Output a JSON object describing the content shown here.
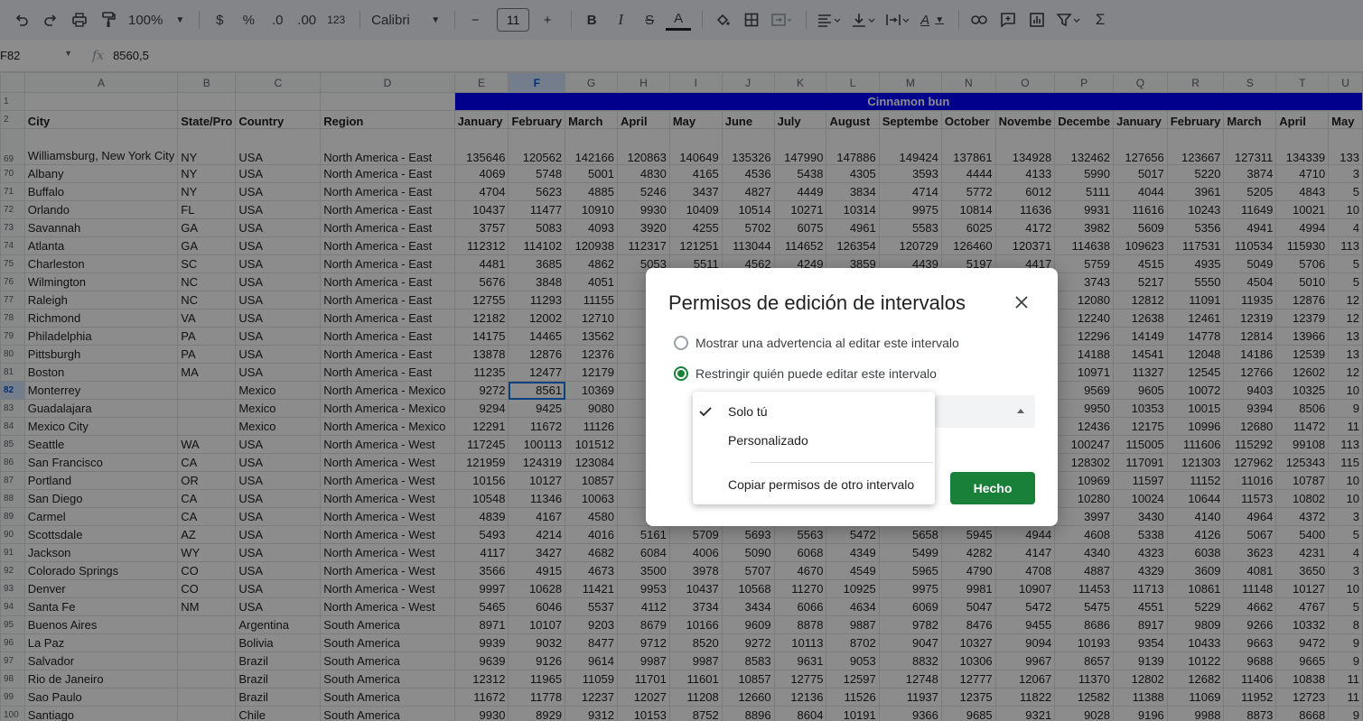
{
  "toolbar": {
    "zoom": "100%",
    "currency": "$",
    "percent": "%",
    "dec_decrease": ".0",
    "dec_increase": ".00",
    "number_format": "123",
    "font": "Calibri",
    "font_size": "11",
    "bold": "B",
    "italic": "I",
    "strike": "S",
    "text_color": "A",
    "text_rotate": "A",
    "sum": "Σ"
  },
  "formula_bar": {
    "cell_ref": "F82",
    "fx": "fx",
    "value": "8560,5"
  },
  "columns": [
    "A",
    "B",
    "C",
    "D",
    "E",
    "F",
    "G",
    "H",
    "I",
    "J",
    "K",
    "L",
    "M",
    "N",
    "O",
    "P",
    "Q",
    "R",
    "S",
    "T",
    "U"
  ],
  "banner": "Cinnamon bun",
  "headers": [
    "City",
    "State/Pro",
    "Country",
    "Region",
    "January",
    "February",
    "March",
    "April",
    "May",
    "June",
    "July",
    "August",
    "Septembe",
    "October",
    "Novembe",
    "Decembe",
    "January",
    "February",
    "March",
    "April",
    "May"
  ],
  "rows": [
    {
      "n": "69",
      "c": [
        "Williamsburg, New York City",
        "NY",
        "USA",
        "North America - East",
        "135646",
        "120562",
        "142166",
        "120863",
        "140649",
        "135326",
        "147990",
        "147886",
        "149424",
        "137861",
        "134928",
        "132462",
        "127656",
        "123667",
        "127311",
        "134339",
        "133"
      ]
    },
    {
      "n": "70",
      "c": [
        "Albany",
        "NY",
        "USA",
        "North America - East",
        "4069",
        "5748",
        "5001",
        "4830",
        "4165",
        "4536",
        "5438",
        "4305",
        "3593",
        "4444",
        "4133",
        "5990",
        "5017",
        "5220",
        "3874",
        "4710",
        "3"
      ]
    },
    {
      "n": "71",
      "c": [
        "Buffalo",
        "NY",
        "USA",
        "North America - East",
        "4704",
        "5623",
        "4885",
        "5246",
        "3437",
        "4827",
        "4449",
        "3834",
        "4714",
        "5772",
        "6012",
        "5111",
        "4044",
        "3961",
        "5205",
        "4843",
        "5"
      ]
    },
    {
      "n": "72",
      "c": [
        "Orlando",
        "FL",
        "USA",
        "North America - East",
        "10437",
        "11477",
        "10910",
        "9930",
        "10409",
        "10514",
        "10271",
        "10314",
        "9975",
        "10814",
        "11636",
        "9931",
        "11616",
        "10243",
        "11649",
        "10021",
        "10"
      ]
    },
    {
      "n": "73",
      "c": [
        "Savannah",
        "GA",
        "USA",
        "North America - East",
        "3757",
        "5083",
        "4093",
        "3920",
        "4255",
        "5702",
        "6075",
        "4961",
        "5583",
        "6025",
        "4172",
        "3982",
        "5609",
        "5356",
        "4941",
        "4994",
        "4"
      ]
    },
    {
      "n": "74",
      "c": [
        "Atlanta",
        "GA",
        "USA",
        "North America - East",
        "112312",
        "114102",
        "120938",
        "112317",
        "121251",
        "113044",
        "114652",
        "126354",
        "120729",
        "126460",
        "120371",
        "114638",
        "109623",
        "117531",
        "110534",
        "115930",
        "113"
      ]
    },
    {
      "n": "75",
      "c": [
        "Charleston",
        "SC",
        "USA",
        "North America - East",
        "4481",
        "3685",
        "4862",
        "5053",
        "5511",
        "4562",
        "4249",
        "3859",
        "4439",
        "5197",
        "4417",
        "5759",
        "4515",
        "4935",
        "5049",
        "5706",
        "5"
      ]
    },
    {
      "n": "76",
      "c": [
        "Wilmington",
        "NC",
        "USA",
        "North America - East",
        "5676",
        "3848",
        "4051",
        "4",
        "",
        "",
        "",
        "",
        "",
        "",
        "",
        "3743",
        "5217",
        "5550",
        "4504",
        "5010",
        "5"
      ]
    },
    {
      "n": "77",
      "c": [
        "Raleigh",
        "NC",
        "USA",
        "North America - East",
        "12755",
        "11293",
        "11155",
        "11",
        "",
        "",
        "",
        "",
        "",
        "",
        "",
        "12080",
        "12812",
        "11091",
        "11935",
        "12876",
        "12"
      ]
    },
    {
      "n": "78",
      "c": [
        "Richmond",
        "VA",
        "USA",
        "North America - East",
        "12182",
        "12002",
        "12710",
        "12",
        "",
        "",
        "",
        "",
        "",
        "",
        "",
        "12240",
        "12638",
        "12461",
        "12319",
        "12379",
        "12"
      ]
    },
    {
      "n": "79",
      "c": [
        "Philadelphia",
        "PA",
        "USA",
        "North America - East",
        "14175",
        "14465",
        "13562",
        "12",
        "",
        "",
        "",
        "",
        "",
        "",
        "",
        "12296",
        "14149",
        "14778",
        "12814",
        "13966",
        "13"
      ]
    },
    {
      "n": "80",
      "c": [
        "Pittsburgh",
        "PA",
        "USA",
        "North America - East",
        "13878",
        "12876",
        "12376",
        "13",
        "",
        "",
        "",
        "",
        "",
        "",
        "",
        "14188",
        "14541",
        "12048",
        "14186",
        "12539",
        "13"
      ]
    },
    {
      "n": "81",
      "c": [
        "Boston",
        "MA",
        "USA",
        "North America - East",
        "11235",
        "12477",
        "12179",
        "11",
        "",
        "",
        "",
        "",
        "",
        "",
        "",
        "10971",
        "11327",
        "12545",
        "12766",
        "12602",
        "12"
      ]
    },
    {
      "n": "82",
      "c": [
        "Monterrey",
        "",
        "Mexico",
        "North America - Mexico",
        "9272",
        "8561",
        "10369",
        "8",
        "",
        "",
        "",
        "",
        "",
        "",
        "",
        "9569",
        "9605",
        "10072",
        "9403",
        "10325",
        "10"
      ]
    },
    {
      "n": "83",
      "c": [
        "Guadalajara",
        "",
        "Mexico",
        "North America - Mexico",
        "9294",
        "9425",
        "9080",
        "9",
        "",
        "",
        "",
        "",
        "",
        "",
        "",
        "9950",
        "10353",
        "10015",
        "9394",
        "8506",
        "9"
      ]
    },
    {
      "n": "84",
      "c": [
        "Mexico City",
        "",
        "Mexico",
        "North America - Mexico",
        "12291",
        "11672",
        "11126",
        "11",
        "",
        "",
        "",
        "",
        "",
        "",
        "",
        "12436",
        "12175",
        "10996",
        "12680",
        "11472",
        "11"
      ]
    },
    {
      "n": "85",
      "c": [
        "Seattle",
        "WA",
        "USA",
        "North America - West",
        "117245",
        "100113",
        "101512",
        "104",
        "",
        "",
        "",
        "",
        "",
        "",
        "",
        "100247",
        "115005",
        "111606",
        "115292",
        "99108",
        "113"
      ]
    },
    {
      "n": "86",
      "c": [
        "San Francisco",
        "CA",
        "USA",
        "North America - West",
        "121959",
        "124319",
        "123084",
        "110",
        "",
        "",
        "",
        "",
        "",
        "",
        "",
        "128302",
        "117091",
        "121303",
        "127962",
        "125343",
        "115"
      ]
    },
    {
      "n": "87",
      "c": [
        "Portland",
        "OR",
        "USA",
        "North America - West",
        "10156",
        "10127",
        "10857",
        "10",
        "",
        "",
        "",
        "",
        "",
        "",
        "",
        "10969",
        "11597",
        "11152",
        "11016",
        "10787",
        "10"
      ]
    },
    {
      "n": "88",
      "c": [
        "San Diego",
        "CA",
        "USA",
        "North America - West",
        "10548",
        "11346",
        "10063",
        "11",
        "",
        "",
        "",
        "",
        "",
        "",
        "",
        "10280",
        "10024",
        "10644",
        "11573",
        "10802",
        "10"
      ]
    },
    {
      "n": "89",
      "c": [
        "Carmel",
        "CA",
        "USA",
        "North America - West",
        "4839",
        "4167",
        "4580",
        "4",
        "",
        "",
        "",
        "",
        "",
        "",
        "",
        "3997",
        "3430",
        "4140",
        "4964",
        "4372",
        "3"
      ]
    },
    {
      "n": "90",
      "c": [
        "Scottsdale",
        "AZ",
        "USA",
        "North America - West",
        "5493",
        "4214",
        "4016",
        "5161",
        "5709",
        "5693",
        "5563",
        "5472",
        "5658",
        "5945",
        "4944",
        "4608",
        "5338",
        "4126",
        "5067",
        "5400",
        "5"
      ]
    },
    {
      "n": "91",
      "c": [
        "Jackson",
        "WY",
        "USA",
        "North America - West",
        "4117",
        "3427",
        "4682",
        "6084",
        "4006",
        "5090",
        "6068",
        "4349",
        "5499",
        "4282",
        "4147",
        "4340",
        "4323",
        "6038",
        "3623",
        "4231",
        "4"
      ]
    },
    {
      "n": "92",
      "c": [
        "Colorado Springs",
        "CO",
        "USA",
        "North America - West",
        "3566",
        "4915",
        "4673",
        "3500",
        "3978",
        "5707",
        "4670",
        "4549",
        "5965",
        "4790",
        "4708",
        "4887",
        "4329",
        "3609",
        "4081",
        "3650",
        "3"
      ]
    },
    {
      "n": "93",
      "c": [
        "Denver",
        "CO",
        "USA",
        "North America - West",
        "9997",
        "10628",
        "11421",
        "9953",
        "10437",
        "10568",
        "11270",
        "10925",
        "9975",
        "9981",
        "10907",
        "11453",
        "11713",
        "10861",
        "11148",
        "10127",
        "10"
      ]
    },
    {
      "n": "94",
      "c": [
        "Santa Fe",
        "NM",
        "USA",
        "North America - West",
        "5465",
        "6046",
        "5537",
        "4112",
        "3734",
        "3434",
        "6066",
        "4634",
        "6069",
        "5047",
        "5472",
        "5475",
        "4551",
        "5229",
        "4662",
        "4767",
        "5"
      ]
    },
    {
      "n": "95",
      "c": [
        "Buenos Aires",
        "",
        "Argentina",
        "South America",
        "8971",
        "10107",
        "9203",
        "8679",
        "10166",
        "9609",
        "8878",
        "9887",
        "9782",
        "8476",
        "9455",
        "8686",
        "8917",
        "9809",
        "9266",
        "10332",
        "8"
      ]
    },
    {
      "n": "96",
      "c": [
        "La Paz",
        "",
        "Bolivia",
        "South America",
        "9939",
        "9032",
        "8477",
        "9712",
        "8520",
        "9272",
        "10113",
        "8702",
        "9047",
        "10327",
        "9094",
        "10193",
        "9354",
        "10433",
        "9663",
        "9472",
        "9"
      ]
    },
    {
      "n": "97",
      "c": [
        "Salvador",
        "",
        "Brazil",
        "South America",
        "9639",
        "9126",
        "9614",
        "9987",
        "9987",
        "8583",
        "9631",
        "9053",
        "8832",
        "10306",
        "9967",
        "8657",
        "9139",
        "10122",
        "9688",
        "9665",
        "9"
      ]
    },
    {
      "n": "98",
      "c": [
        "Rio de Janeiro",
        "",
        "Brazil",
        "South America",
        "12312",
        "11965",
        "11059",
        "11701",
        "11601",
        "10857",
        "12775",
        "12597",
        "12748",
        "12777",
        "12067",
        "11370",
        "12802",
        "12682",
        "11406",
        "10838",
        "11"
      ]
    },
    {
      "n": "99",
      "c": [
        "Sao Paulo",
        "",
        "Brazil",
        "South America",
        "11672",
        "11778",
        "12237",
        "12027",
        "11208",
        "12660",
        "12136",
        "11526",
        "11937",
        "12375",
        "11822",
        "12582",
        "11388",
        "11069",
        "11952",
        "12723",
        "11"
      ]
    },
    {
      "n": "100",
      "c": [
        "Santiago",
        "",
        "Chile",
        "South America",
        "9930",
        "8929",
        "9312",
        "10153",
        "8752",
        "8896",
        "8604",
        "10191",
        "9366",
        "9685",
        "9321",
        "9028",
        "9196",
        "9988",
        "8873",
        "8668",
        "9"
      ]
    }
  ],
  "dialog": {
    "title": "Permisos de edición de intervalos",
    "option_warn": "Mostrar una advertencia al editar este intervalo",
    "option_restrict": "Restringir quién puede editar este intervalo",
    "done": "Hecho"
  },
  "menu": {
    "items": [
      "Solo tú",
      "Personalizado",
      "Copiar permisos de otro intervalo"
    ],
    "selected": "Solo tú"
  }
}
